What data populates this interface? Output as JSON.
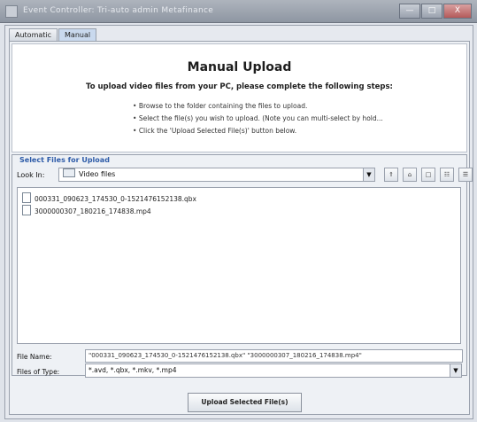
{
  "window": {
    "title": "Event Controller: Tri-auto admin Metafinance",
    "buttons": [
      "—",
      "□",
      "X"
    ]
  },
  "tabs": [
    {
      "label": "Automatic",
      "active": false
    },
    {
      "label": "Manual",
      "active": true
    }
  ],
  "header": {
    "title": "Manual Upload",
    "subtitle": "To upload video files from your PC, please complete the following steps:",
    "steps": [
      "Browse to the folder containing the files to upload.",
      "Select the file(s) you wish to upload. (Note you can multi-select by hold...",
      "Click the 'Upload Selected File(s)' button below."
    ]
  },
  "chooser": {
    "section_label": "Select Files for Upload",
    "look_in_label": "Look In:",
    "look_in_value": "Video files",
    "toolbar_icons": [
      "up-folder-icon",
      "home-icon",
      "new-folder-icon",
      "list-view-icon",
      "details-view-icon"
    ],
    "files": [
      "000331_090623_174530_0-1521476152138.qbx",
      "3000000307_180216_174838.mp4"
    ],
    "file_name_label": "File Name:",
    "file_name_value": "\"000331_090623_174530_0-1521476152138.qbx\" \"3000000307_180216_174838.mp4\"",
    "file_type_label": "Files of Type:",
    "file_type_value": "*.avd, *.qbx, *.mkv, *.mp4"
  },
  "upload_button": "Upload Selected File(s)"
}
